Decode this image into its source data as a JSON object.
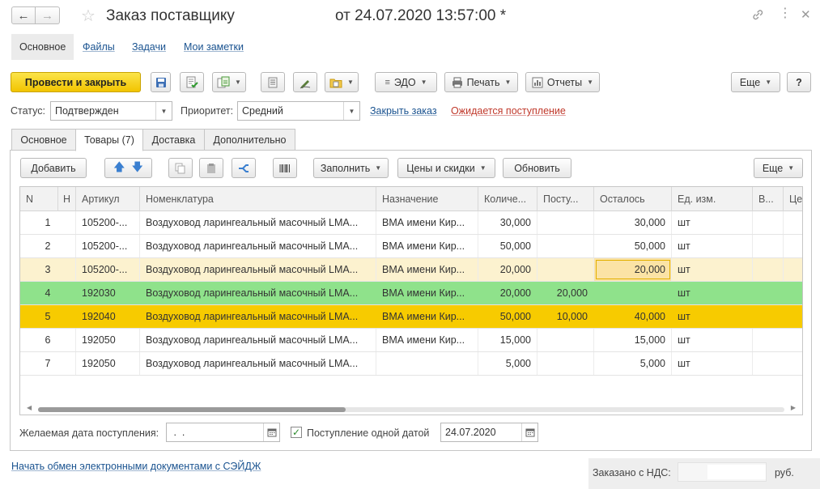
{
  "window": {
    "title": "Заказ поставщику",
    "date_text": "от 24.07.2020 13:57:00 *",
    "back_icon": "arrow-left-icon",
    "forward_icon": "arrow-right-icon"
  },
  "section_tabs": [
    {
      "label": "Основное",
      "active": true
    },
    {
      "label": "Файлы"
    },
    {
      "label": "Задачи"
    },
    {
      "label": "Мои заметки"
    }
  ],
  "toolbar": {
    "post_close": "Провести и закрыть",
    "edo": "ЭДО",
    "print": "Печать",
    "reports": "Отчеты",
    "more": "Еще",
    "help": "?"
  },
  "status": {
    "status_label": "Статус:",
    "status_value": "Подтвержден",
    "priority_label": "Приоритет:",
    "priority_value": "Средний",
    "close_order_link": "Закрыть заказ",
    "awaiting_link": "Ожидается поступление"
  },
  "content_tabs": [
    "Основное",
    "Товары (7)",
    "Доставка",
    "Дополнительно"
  ],
  "table_toolbar": {
    "add": "Добавить",
    "fill": "Заполнить",
    "prices": "Цены и скидки",
    "refresh": "Обновить",
    "more": "Еще"
  },
  "table": {
    "columns": [
      "N",
      "Н",
      "Артикул",
      "Номенклатура",
      "Назначение",
      "Количе...",
      "Посту...",
      "Осталось",
      "Ед. изм.",
      "В...",
      "Це"
    ],
    "rows": [
      {
        "n": "1",
        "art": "105200-...",
        "nom": "Воздуховод ларингеальный масочный LMA...",
        "dest": "ВМА имени Кир...",
        "qty": "30,000",
        "recv": "",
        "left": "30,000",
        "unit": "шт"
      },
      {
        "n": "2",
        "art": "105200-...",
        "nom": "Воздуховод ларингеальный масочный LMA...",
        "dest": "ВМА имени Кир...",
        "qty": "50,000",
        "recv": "",
        "left": "50,000",
        "unit": "шт"
      },
      {
        "n": "3",
        "art": "105200-...",
        "nom": "Воздуховод ларингеальный масочный LMA...",
        "dest": "ВМА имени Кир...",
        "qty": "20,000",
        "recv": "",
        "left": "20,000",
        "unit": "шт"
      },
      {
        "n": "4",
        "art": "192030",
        "nom": "Воздуховод ларингеальный масочный LMA...",
        "dest": "ВМА имени Кир...",
        "qty": "20,000",
        "recv": "20,000",
        "left": "",
        "unit": "шт"
      },
      {
        "n": "5",
        "art": "192040",
        "nom": "Воздуховод ларингеальный масочный LMA...",
        "dest": "ВМА имени Кир...",
        "qty": "50,000",
        "recv": "10,000",
        "left": "40,000",
        "unit": "шт"
      },
      {
        "n": "6",
        "art": "192050",
        "nom": "Воздуховод ларингеальный масочный LMA...",
        "dest": "ВМА имени Кир...",
        "qty": "15,000",
        "recv": "",
        "left": "15,000",
        "unit": "шт"
      },
      {
        "n": "7",
        "art": "192050",
        "nom": "Воздуховод ларингеальный масочный LMA...",
        "dest": "",
        "qty": "5,000",
        "recv": "",
        "left": "5,000",
        "unit": "шт"
      }
    ]
  },
  "bottom": {
    "desired_date_label": "Желаемая дата поступления:",
    "desired_date_value": " .  .",
    "single_date_label": "Поступление одной датой",
    "single_date_checked": true,
    "single_date_value": "24.07.2020"
  },
  "footer": {
    "edo_link": "Начать обмен электронными документами с СЭЙДЖ",
    "total_label": "Заказано с НДС:",
    "currency": "руб."
  },
  "colors": {
    "primary_yellow": "#f2c400",
    "row_green": "#8fe28b",
    "row_orange": "#f7cb00",
    "row_selected": "#fcf2cf",
    "link_blue": "#1a5390",
    "link_red": "#c0392b"
  }
}
